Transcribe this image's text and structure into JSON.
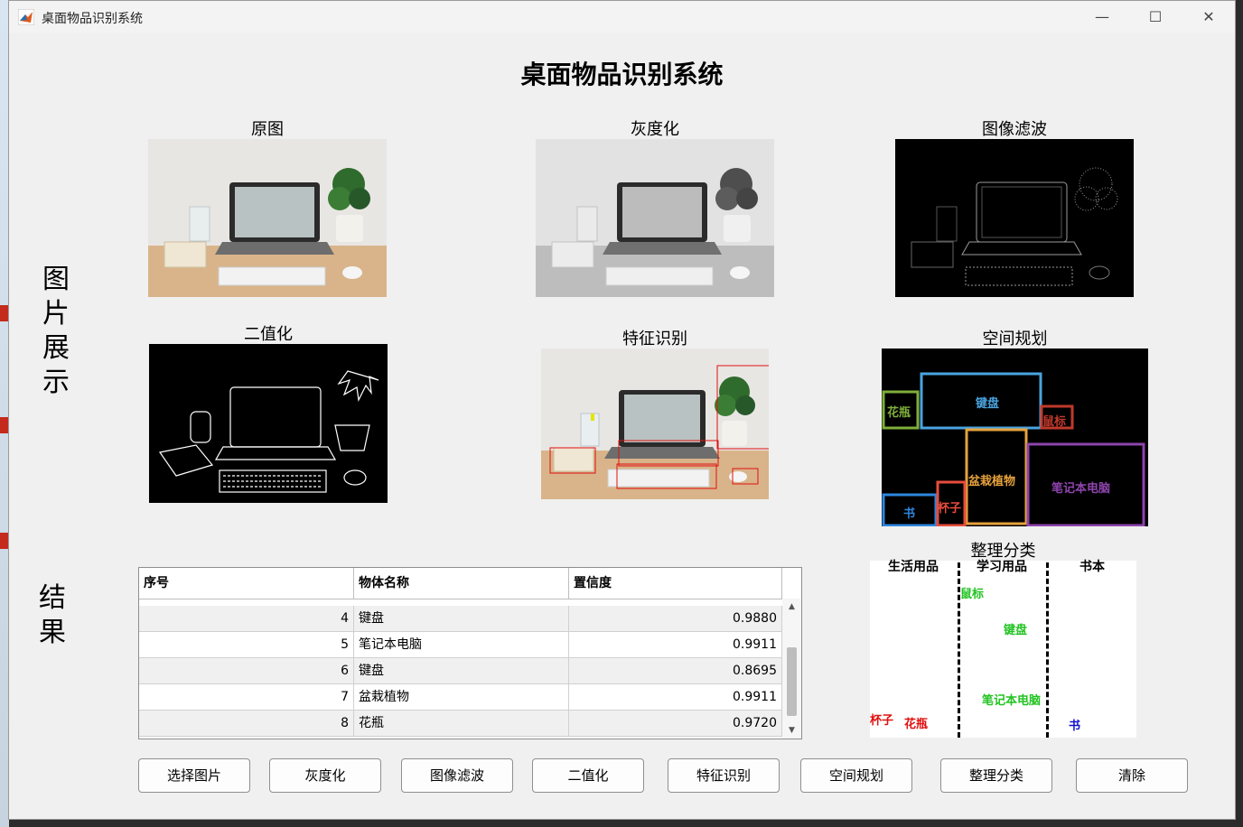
{
  "window": {
    "title": "桌面物品识别系统",
    "controls": [
      "—",
      "☐",
      "✕"
    ]
  },
  "app_title": "桌面物品识别系统",
  "side_labels": {
    "images": [
      "图",
      "片",
      "展",
      "示"
    ],
    "results": [
      "结",
      "果"
    ]
  },
  "panels": {
    "original": "原图",
    "gray": "灰度化",
    "filter": "图像滤波",
    "binary": "二值化",
    "feature": "特征识别",
    "space": "空间规划",
    "sort": "整理分类"
  },
  "space_plan_boxes": [
    {
      "label": "花瓶",
      "color": "#7fae3a"
    },
    {
      "label": "键盘",
      "color": "#4aa3df"
    },
    {
      "label": "鼠标",
      "color": "#c0392b"
    },
    {
      "label": "盆栽植物",
      "color": "#e6a23c"
    },
    {
      "label": "笔记本电脑",
      "color": "#8e44ad"
    },
    {
      "label": "书",
      "color": "#2e86de"
    },
    {
      "label": "杯子",
      "color": "#e74c3c"
    }
  ],
  "sort_panel": {
    "columns": [
      "生活用品",
      "学习用品",
      "书本"
    ],
    "items": [
      {
        "label": "鼠标",
        "color": "#22c322"
      },
      {
        "label": "键盘",
        "color": "#22c322"
      },
      {
        "label": "笔记本电脑",
        "color": "#22c322"
      },
      {
        "label": "杯子",
        "color": "#e01010"
      },
      {
        "label": "花瓶",
        "color": "#e01010"
      },
      {
        "label": "书",
        "color": "#1010d0"
      }
    ]
  },
  "table": {
    "headers": [
      "序号",
      "物体名称",
      "置信度"
    ],
    "rows": [
      {
        "index": "4",
        "name": "键盘",
        "conf": "0.9880"
      },
      {
        "index": "5",
        "name": "笔记本电脑",
        "conf": "0.9911"
      },
      {
        "index": "6",
        "name": "键盘",
        "conf": "0.8695"
      },
      {
        "index": "7",
        "name": "盆栽植物",
        "conf": "0.9911"
      },
      {
        "index": "8",
        "name": "花瓶",
        "conf": "0.9720"
      }
    ]
  },
  "buttons": {
    "select_image": "选择图片",
    "gray": "灰度化",
    "filter": "图像滤波",
    "binary": "二值化",
    "feature": "特征识别",
    "space": "空间规划",
    "sort": "整理分类",
    "clear": "清除"
  }
}
